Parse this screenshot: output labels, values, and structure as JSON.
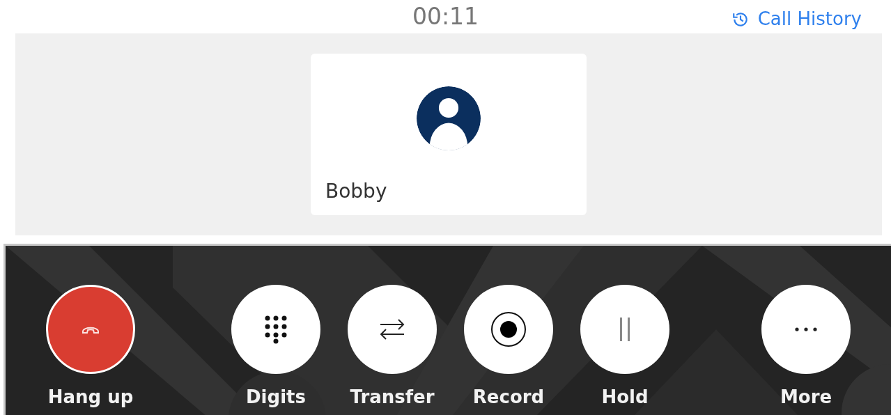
{
  "timer": "00:11",
  "call_history": {
    "label": "Call History"
  },
  "participant": {
    "name": "Bobby"
  },
  "controls": [
    {
      "kind": "hangup",
      "label": "Hang up"
    },
    {
      "kind": "digits",
      "label": "Digits"
    },
    {
      "kind": "transfer",
      "label": "Transfer"
    },
    {
      "kind": "record",
      "label": "Record"
    },
    {
      "kind": "hold",
      "label": "Hold"
    },
    {
      "kind": "more",
      "label": "More"
    }
  ]
}
